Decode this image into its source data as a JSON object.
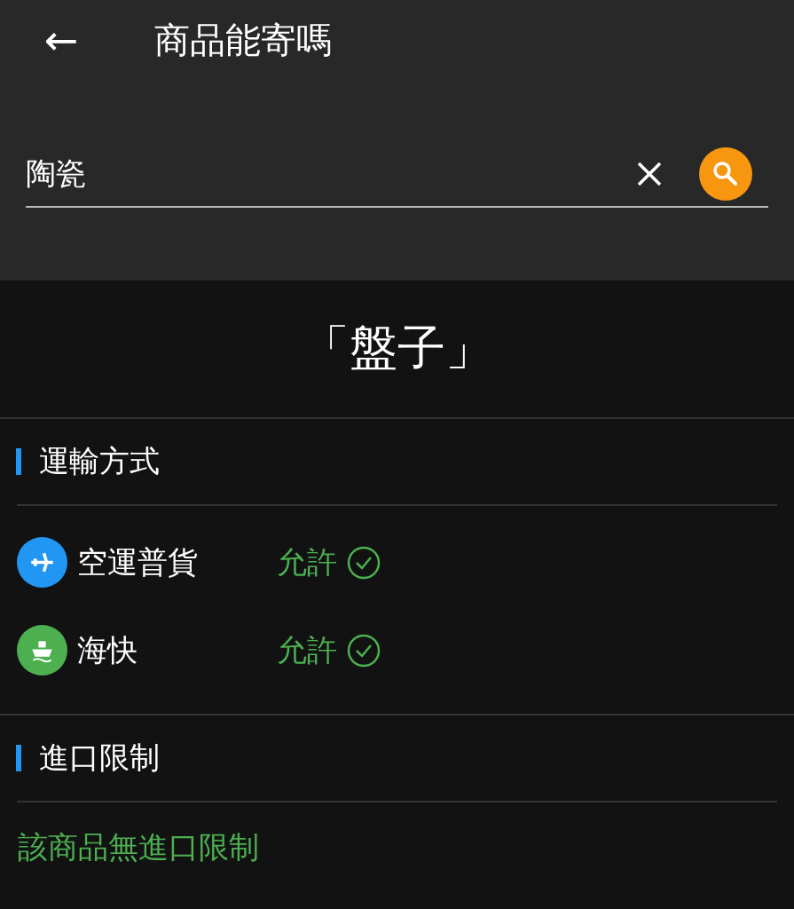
{
  "header": {
    "back_icon": "←",
    "title": "商品能寄嗎"
  },
  "search": {
    "value": "陶瓷"
  },
  "result_title": "「盤子」",
  "sections": [
    {
      "heading": "運輸方式",
      "kind": "methods",
      "methods": [
        {
          "kind": "air",
          "name": "空運普貨",
          "status": "允許",
          "allowed": true
        },
        {
          "kind": "sea",
          "name": "海快",
          "status": "允許",
          "allowed": true
        }
      ]
    },
    {
      "heading": "進口限制",
      "kind": "note",
      "note": "該商品無進口限制"
    }
  ]
}
